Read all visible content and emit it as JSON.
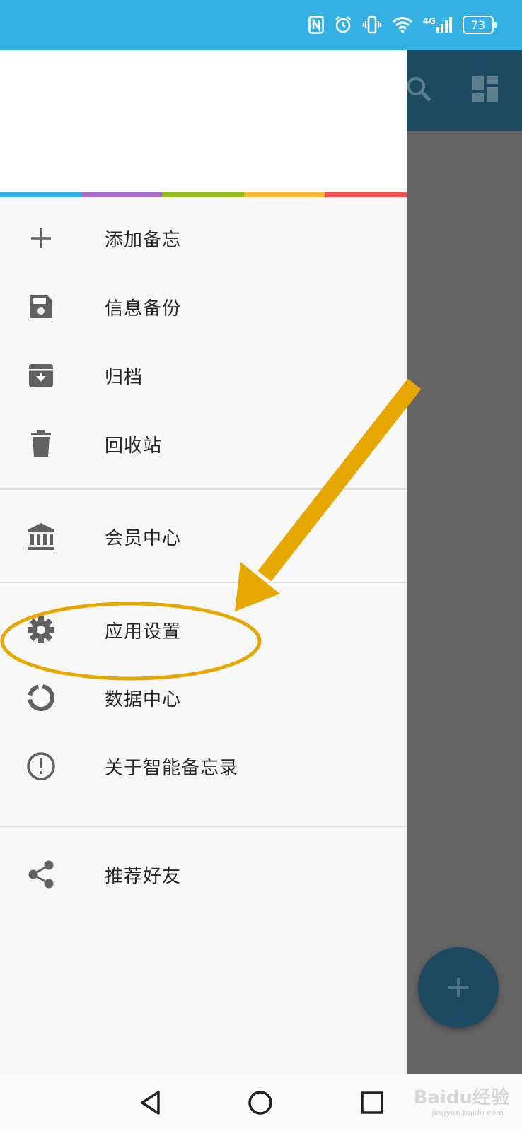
{
  "status_bar": {
    "network_label": "4G",
    "battery_level": "73",
    "icons": [
      "nfc-icon",
      "alarm-icon",
      "vibrate-icon",
      "wifi-icon",
      "signal-icon",
      "battery-icon"
    ]
  },
  "app": {
    "toolbar_icons": [
      "search-icon",
      "layout-icon"
    ],
    "fab_icon": "plus-icon"
  },
  "drawer": {
    "stripe_colors": [
      "#35b1e3",
      "#a86fc6",
      "#94c11f",
      "#f9b93b",
      "#f04e4e"
    ],
    "items": [
      {
        "label": "添加备忘",
        "icon": "plus-icon"
      },
      {
        "label": "信息备份",
        "icon": "save-icon"
      },
      {
        "label": "归档",
        "icon": "archive-icon"
      },
      {
        "label": "回收站",
        "icon": "trash-icon"
      },
      {
        "label": "会员中心",
        "icon": "bank-icon"
      },
      {
        "label": "应用设置",
        "icon": "gear-icon"
      },
      {
        "label": "数据中心",
        "icon": "donut-chart-icon"
      },
      {
        "label": "关于智能备忘录",
        "icon": "info-icon"
      },
      {
        "label": "推荐好友",
        "icon": "share-icon"
      }
    ]
  },
  "nav_bar": {
    "icons": [
      "back-icon",
      "home-icon",
      "recent-apps-icon"
    ]
  },
  "watermark": {
    "text": "Baidu经验",
    "sub": "jingyan.baidu.com"
  },
  "colors": {
    "status_bar": "#35b1e3",
    "toolbar": "#1d4a60",
    "annotation": "#e6a800"
  }
}
